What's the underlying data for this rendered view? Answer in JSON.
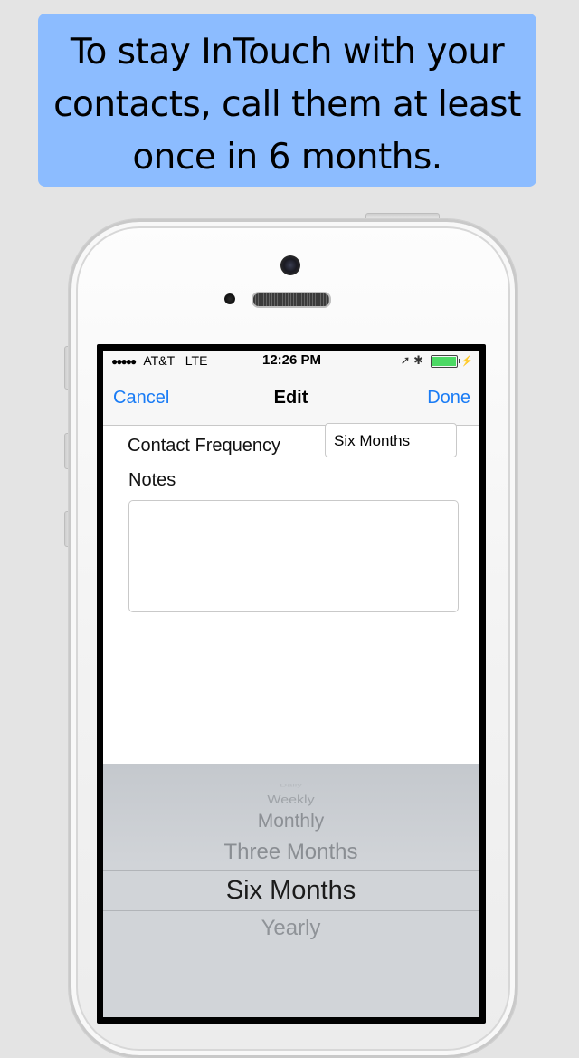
{
  "banner": {
    "line1": "To stay InTouch with your",
    "line2": "contacts, call them at least",
    "line3": "once in 6 months."
  },
  "status_bar": {
    "signal": "●●●●●",
    "carrier": "AT&T",
    "network": "LTE",
    "time": "12:26 PM",
    "icons": "➚ ✱"
  },
  "nav": {
    "cancel": "Cancel",
    "title": "Edit",
    "done": "Done"
  },
  "form": {
    "frequency_label": "Contact Frequency",
    "frequency_value": "Six Months",
    "notes_label": "Notes",
    "notes_value": ""
  },
  "picker": {
    "options": [
      "Daily",
      "Weekly",
      "Monthly",
      "Three Months",
      "Six Months",
      "Yearly"
    ],
    "selected": "Six Months"
  },
  "colors": {
    "banner_bg": "#8cbcff",
    "ios_blue": "#1a7cf5",
    "picker_bg": "#d1d4d8"
  }
}
